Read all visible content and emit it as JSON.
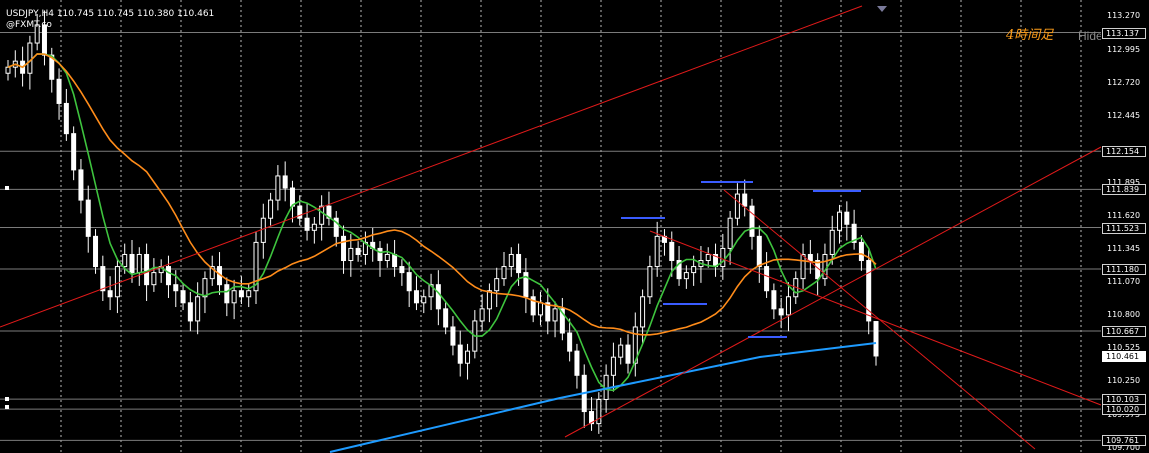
{
  "header": {
    "symbol_line": "USDJPY,H4  110.745 110.745 110.380 110.461",
    "source_label": "@FXMT.co"
  },
  "watermark": "4時间足",
  "hide_button": "Hide",
  "price_axis": {
    "ticks": [
      "113.270",
      "112.995",
      "112.720",
      "112.445",
      "111.895",
      "111.620",
      "111.345",
      "111.070",
      "110.800",
      "110.525",
      "110.250",
      "109.975",
      "109.700"
    ],
    "tick_values": [
      113.27,
      112.995,
      112.72,
      112.445,
      111.895,
      111.62,
      111.345,
      111.07,
      110.8,
      110.525,
      110.25,
      109.975,
      109.7
    ],
    "range": [
      109.69,
      113.34
    ],
    "line_labels": [
      "113.137",
      "112.154",
      "111.839",
      "111.523",
      "111.180",
      "110.667",
      "110.103",
      "110.020",
      "109.761"
    ],
    "line_values": [
      113.137,
      112.154,
      111.839,
      111.523,
      111.18,
      110.667,
      110.103,
      110.02,
      109.761
    ],
    "current_price_label": "110.461",
    "current_price": 110.461
  },
  "colors": {
    "background": "#000000",
    "bull_candle": "#ffffff",
    "bear_candle": "#ffffff",
    "ma_short": "#3ec43e",
    "ma_mid": "#ff8c1a",
    "ma_long": "#1e9bff",
    "trendline": "#e01a1a",
    "level_marks": "#3a5cff",
    "hline": "#9a9a9a",
    "grid": "#d8d8d8"
  },
  "chart_data": {
    "type": "candlestick",
    "symbol": "USDJPY",
    "timeframe": "H4",
    "last_bar": {
      "open": 110.745,
      "high": 110.745,
      "low": 110.38,
      "close": 110.461
    },
    "ylim": [
      109.69,
      113.34
    ],
    "horizontal_levels": [
      113.137,
      112.154,
      111.839,
      111.523,
      111.18,
      110.667,
      110.103,
      110.02,
      109.761
    ],
    "closes": [
      112.85,
      112.9,
      112.8,
      113.05,
      113.2,
      112.95,
      112.75,
      112.55,
      112.3,
      112.0,
      111.75,
      111.45,
      111.2,
      111.0,
      110.95,
      111.2,
      111.3,
      111.15,
      111.3,
      111.05,
      111.15,
      111.2,
      111.05,
      111.0,
      110.9,
      110.75,
      110.95,
      111.1,
      111.2,
      111.05,
      110.9,
      111.0,
      110.95,
      111.0,
      111.4,
      111.6,
      111.75,
      111.95,
      111.85,
      111.7,
      111.6,
      111.5,
      111.55,
      111.7,
      111.6,
      111.45,
      111.25,
      111.35,
      111.3,
      111.4,
      111.35,
      111.25,
      111.3,
      111.2,
      111.15,
      111.0,
      110.9,
      110.95,
      111.05,
      110.85,
      110.7,
      110.55,
      110.4,
      110.5,
      110.75,
      110.85,
      111.0,
      111.1,
      111.2,
      111.3,
      111.15,
      110.95,
      110.8,
      110.9,
      110.75,
      110.85,
      110.65,
      110.5,
      110.3,
      110.0,
      109.9,
      110.1,
      110.3,
      110.45,
      110.55,
      110.4,
      110.7,
      110.95,
      111.2,
      111.45,
      111.4,
      111.25,
      111.1,
      111.15,
      111.2,
      111.25,
      111.3,
      111.2,
      111.35,
      111.6,
      111.8,
      111.7,
      111.45,
      111.2,
      111.0,
      110.85,
      110.8,
      110.95,
      111.1,
      111.3,
      111.25,
      111.1,
      111.3,
      111.5,
      111.65,
      111.55,
      111.4,
      111.25,
      110.75,
      110.46
    ]
  }
}
